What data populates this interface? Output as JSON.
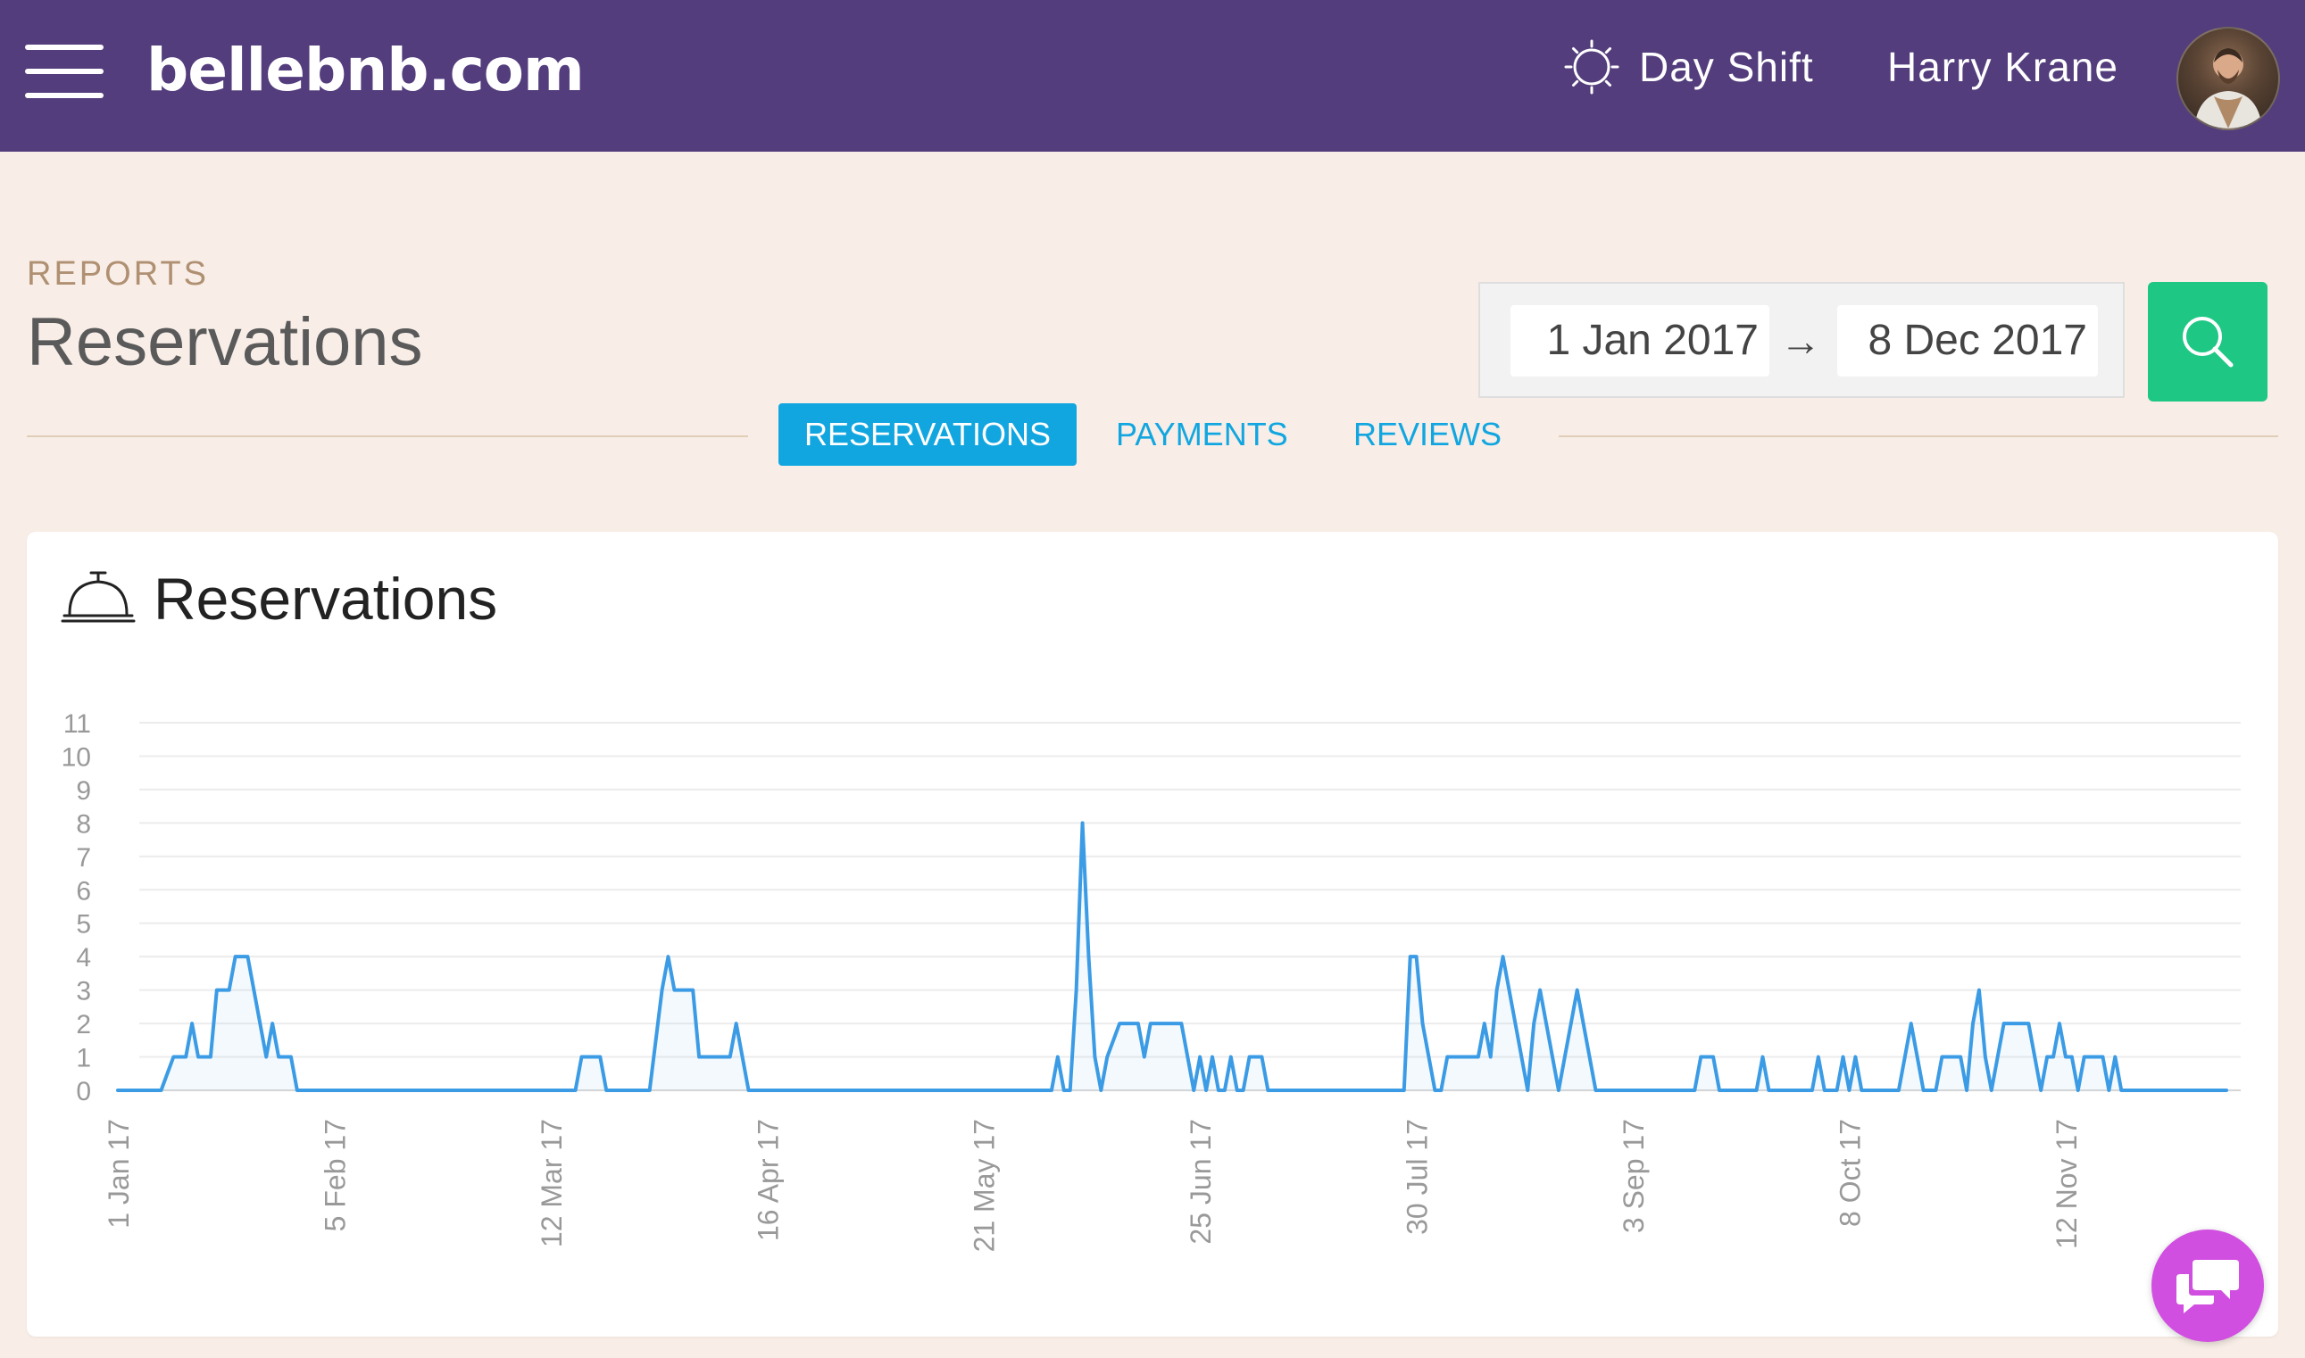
{
  "header": {
    "logo": "bellebnb.com",
    "shift_label": "Day Shift",
    "user_name": "Harry Krane"
  },
  "page": {
    "section_label": "REPORTS",
    "title": "Reservations"
  },
  "date_range": {
    "from": "1 Jan 2017",
    "arrow": "→",
    "to": "8 Dec 2017"
  },
  "tabs": [
    {
      "label": "RESERVATIONS",
      "active": true
    },
    {
      "label": "PAYMENTS",
      "active": false
    },
    {
      "label": "REVIEWS",
      "active": false
    }
  ],
  "card": {
    "title": "Reservations"
  },
  "colors": {
    "header_bg": "#533d7c",
    "accent_blue": "#12a6e0",
    "search_green": "#1fc784",
    "chat_pink": "#d14fe0",
    "line": "#3b9be5"
  },
  "icons": [
    "menu-icon",
    "sun-icon",
    "search-icon",
    "service-bell-icon",
    "chat-icon"
  ],
  "chart_data": {
    "type": "line",
    "title": "",
    "xlabel": "",
    "ylabel": "",
    "ylim": [
      0,
      11
    ],
    "yticks": [
      0,
      1,
      2,
      3,
      4,
      5,
      6,
      7,
      8,
      9,
      10,
      11
    ],
    "grid": true,
    "x_tick_labels": [
      "1 Jan 17",
      "5 Feb 17",
      "12 Mar 17",
      "16 Apr 17",
      "21 May 17",
      "25 Jun 17",
      "30 Jul 17",
      "3 Sep 17",
      "8 Oct 17",
      "12 Nov 17"
    ],
    "x_start": "2017-01-01",
    "x_end": "2017-12-08",
    "series": [
      {
        "points": [
          [
            "2017-01-01",
            0
          ],
          [
            "2017-01-08",
            0
          ],
          [
            "2017-01-10",
            1
          ],
          [
            "2017-01-12",
            1
          ],
          [
            "2017-01-13",
            2
          ],
          [
            "2017-01-14",
            1
          ],
          [
            "2017-01-16",
            1
          ],
          [
            "2017-01-17",
            3
          ],
          [
            "2017-01-19",
            3
          ],
          [
            "2017-01-20",
            4
          ],
          [
            "2017-01-22",
            4
          ],
          [
            "2017-01-23",
            3
          ],
          [
            "2017-01-24",
            2
          ],
          [
            "2017-01-25",
            1
          ],
          [
            "2017-01-26",
            2
          ],
          [
            "2017-01-27",
            1
          ],
          [
            "2017-01-29",
            1
          ],
          [
            "2017-01-30",
            0
          ],
          [
            "2017-03-16",
            0
          ],
          [
            "2017-03-17",
            1
          ],
          [
            "2017-03-20",
            1
          ],
          [
            "2017-03-21",
            0
          ],
          [
            "2017-03-28",
            0
          ],
          [
            "2017-03-30",
            3
          ],
          [
            "2017-03-31",
            4
          ],
          [
            "2017-04-01",
            3
          ],
          [
            "2017-04-04",
            3
          ],
          [
            "2017-04-05",
            1
          ],
          [
            "2017-04-10",
            1
          ],
          [
            "2017-04-11",
            2
          ],
          [
            "2017-04-13",
            0
          ],
          [
            "2017-06-01",
            0
          ],
          [
            "2017-06-02",
            1
          ],
          [
            "2017-06-03",
            0
          ],
          [
            "2017-06-04",
            0
          ],
          [
            "2017-06-05",
            3
          ],
          [
            "2017-06-06",
            8
          ],
          [
            "2017-06-07",
            4
          ],
          [
            "2017-06-08",
            1
          ],
          [
            "2017-06-09",
            0
          ],
          [
            "2017-06-10",
            1
          ],
          [
            "2017-06-12",
            2
          ],
          [
            "2017-06-15",
            2
          ],
          [
            "2017-06-16",
            1
          ],
          [
            "2017-06-17",
            2
          ],
          [
            "2017-06-22",
            2
          ],
          [
            "2017-06-23",
            1
          ],
          [
            "2017-06-24",
            0
          ],
          [
            "2017-06-25",
            1
          ],
          [
            "2017-06-26",
            0
          ],
          [
            "2017-06-27",
            1
          ],
          [
            "2017-06-28",
            0
          ],
          [
            "2017-06-29",
            0
          ],
          [
            "2017-06-30",
            1
          ],
          [
            "2017-07-01",
            0
          ],
          [
            "2017-07-02",
            0
          ],
          [
            "2017-07-03",
            1
          ],
          [
            "2017-07-05",
            1
          ],
          [
            "2017-07-06",
            0
          ],
          [
            "2017-07-28",
            0
          ],
          [
            "2017-07-29",
            4
          ],
          [
            "2017-07-30",
            4
          ],
          [
            "2017-07-31",
            2
          ],
          [
            "2017-08-01",
            1
          ],
          [
            "2017-08-02",
            0
          ],
          [
            "2017-08-03",
            0
          ],
          [
            "2017-08-04",
            1
          ],
          [
            "2017-08-09",
            1
          ],
          [
            "2017-08-10",
            2
          ],
          [
            "2017-08-11",
            1
          ],
          [
            "2017-08-12",
            3
          ],
          [
            "2017-08-13",
            4
          ],
          [
            "2017-08-14",
            3
          ],
          [
            "2017-08-16",
            1
          ],
          [
            "2017-08-17",
            0
          ],
          [
            "2017-08-18",
            2
          ],
          [
            "2017-08-19",
            3
          ],
          [
            "2017-08-20",
            2
          ],
          [
            "2017-08-21",
            1
          ],
          [
            "2017-08-22",
            0
          ],
          [
            "2017-08-23",
            1
          ],
          [
            "2017-08-24",
            2
          ],
          [
            "2017-08-25",
            3
          ],
          [
            "2017-08-26",
            2
          ],
          [
            "2017-08-27",
            1
          ],
          [
            "2017-08-28",
            0
          ],
          [
            "2017-09-13",
            0
          ],
          [
            "2017-09-14",
            1
          ],
          [
            "2017-09-16",
            1
          ],
          [
            "2017-09-17",
            0
          ],
          [
            "2017-09-23",
            0
          ],
          [
            "2017-09-24",
            1
          ],
          [
            "2017-09-25",
            0
          ],
          [
            "2017-10-02",
            0
          ],
          [
            "2017-10-03",
            1
          ],
          [
            "2017-10-04",
            0
          ],
          [
            "2017-10-06",
            0
          ],
          [
            "2017-10-07",
            1
          ],
          [
            "2017-10-08",
            0
          ],
          [
            "2017-10-09",
            1
          ],
          [
            "2017-10-10",
            0
          ],
          [
            "2017-10-16",
            0
          ],
          [
            "2017-10-18",
            2
          ],
          [
            "2017-10-19",
            1
          ],
          [
            "2017-10-20",
            0
          ],
          [
            "2017-10-22",
            0
          ],
          [
            "2017-10-23",
            1
          ],
          [
            "2017-10-26",
            1
          ],
          [
            "2017-10-27",
            0
          ],
          [
            "2017-10-28",
            2
          ],
          [
            "2017-10-29",
            3
          ],
          [
            "2017-10-30",
            1
          ],
          [
            "2017-10-31",
            0
          ],
          [
            "2017-11-01",
            1
          ],
          [
            "2017-11-02",
            2
          ],
          [
            "2017-11-06",
            2
          ],
          [
            "2017-11-07",
            1
          ],
          [
            "2017-11-08",
            0
          ],
          [
            "2017-11-09",
            1
          ],
          [
            "2017-11-10",
            1
          ],
          [
            "2017-11-11",
            2
          ],
          [
            "2017-11-12",
            1
          ],
          [
            "2017-11-13",
            1
          ],
          [
            "2017-11-14",
            0
          ],
          [
            "2017-11-15",
            1
          ],
          [
            "2017-11-18",
            1
          ],
          [
            "2017-11-19",
            0
          ],
          [
            "2017-11-20",
            1
          ],
          [
            "2017-11-21",
            0
          ],
          [
            "2017-12-08",
            0
          ]
        ]
      }
    ]
  }
}
